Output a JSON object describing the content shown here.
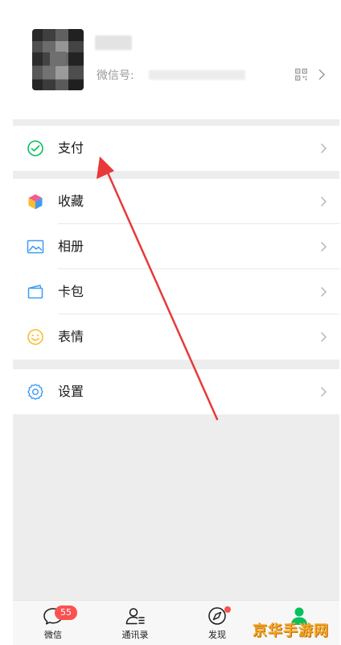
{
  "profile": {
    "wechat_id_label": "微信号:"
  },
  "menu": {
    "pay": "支付",
    "favorites": "收藏",
    "album": "相册",
    "cards": "卡包",
    "stickers": "表情",
    "settings": "设置"
  },
  "tabs": {
    "chats": "微信",
    "chats_badge": "55",
    "contacts": "通讯录",
    "discover": "发现",
    "me": "我"
  },
  "watermark": "京华手游网",
  "colors": {
    "accent_green": "#07c160",
    "badge_red": "#fa5151",
    "annotation_arrow": "#e8393a"
  }
}
